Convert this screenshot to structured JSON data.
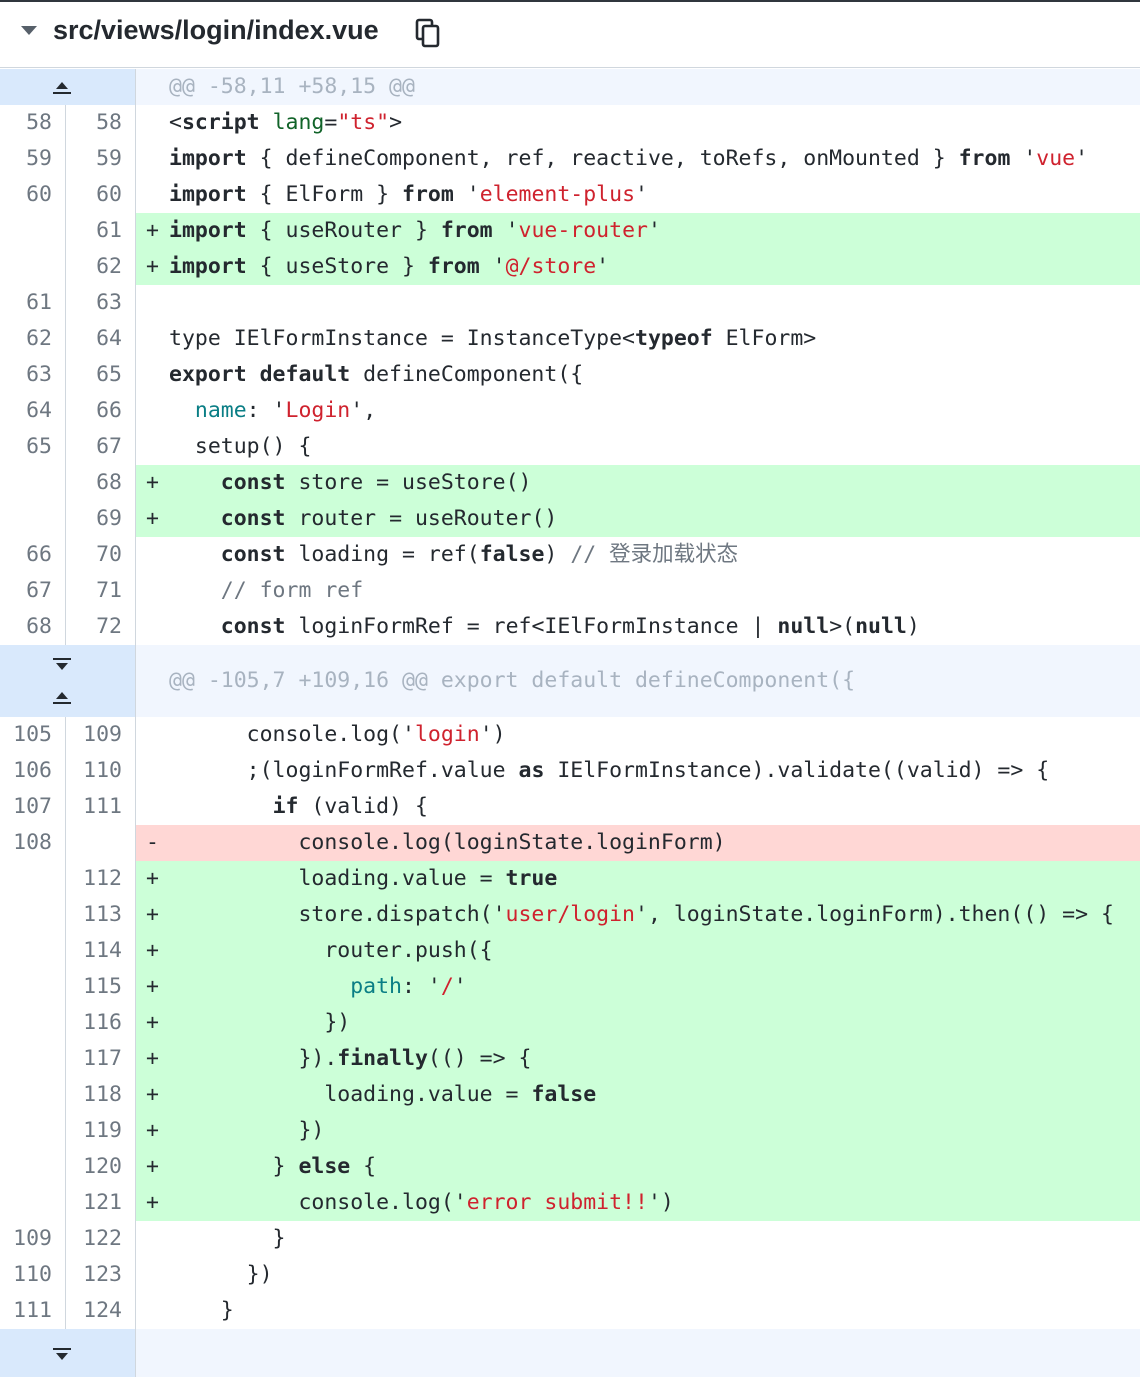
{
  "file": {
    "path": "src/views/login/index.vue",
    "icons": {
      "toggle": "chevron-down-icon",
      "copy": "copy-icon"
    }
  },
  "colors": {
    "added_bg": "#ccffd8",
    "deleted_bg": "#ffd7d5",
    "hunk_bg": "#f1f6fe",
    "expander_bg": "#d9e9fc",
    "string": "#cf222e",
    "property": "#0a7e85"
  },
  "rows": [
    {
      "type": "hunk",
      "expand": "up",
      "text": "@@ -58,11 +58,15 @@"
    },
    {
      "type": "ctx",
      "old": "58",
      "new": "58",
      "parts": [
        [
          "p",
          "<"
        ],
        [
          "k",
          "script"
        ],
        [
          "p",
          " "
        ],
        [
          "a",
          "lang"
        ],
        [
          "p",
          "="
        ],
        [
          "s",
          "\"ts\""
        ],
        [
          "p",
          ">"
        ]
      ]
    },
    {
      "type": "ctx",
      "old": "59",
      "new": "59",
      "parts": [
        [
          "k",
          "import"
        ],
        [
          "p",
          " { defineComponent, ref, reactive, toRefs, onMounted } "
        ],
        [
          "k",
          "from"
        ],
        [
          "p",
          " '"
        ],
        [
          "s",
          "vue"
        ],
        [
          "p",
          "'"
        ]
      ]
    },
    {
      "type": "ctx",
      "old": "60",
      "new": "60",
      "parts": [
        [
          "k",
          "import"
        ],
        [
          "p",
          " { ElForm } "
        ],
        [
          "k",
          "from"
        ],
        [
          "p",
          " '"
        ],
        [
          "s",
          "element-plus"
        ],
        [
          "p",
          "'"
        ]
      ]
    },
    {
      "type": "add",
      "old": "",
      "new": "61",
      "parts": [
        [
          "k",
          "import"
        ],
        [
          "p",
          " { useRouter } "
        ],
        [
          "k",
          "from"
        ],
        [
          "p",
          " '"
        ],
        [
          "s",
          "vue-router"
        ],
        [
          "p",
          "'"
        ]
      ]
    },
    {
      "type": "add",
      "old": "",
      "new": "62",
      "parts": [
        [
          "k",
          "import"
        ],
        [
          "p",
          " { useStore } "
        ],
        [
          "k",
          "from"
        ],
        [
          "p",
          " '"
        ],
        [
          "s",
          "@/store"
        ],
        [
          "p",
          "'"
        ]
      ]
    },
    {
      "type": "ctx",
      "old": "61",
      "new": "63",
      "parts": []
    },
    {
      "type": "ctx",
      "old": "62",
      "new": "64",
      "parts": [
        [
          "p",
          "type IElFormInstance = InstanceType<"
        ],
        [
          "k",
          "typeof"
        ],
        [
          "p",
          " ElForm>"
        ]
      ]
    },
    {
      "type": "ctx",
      "old": "63",
      "new": "65",
      "parts": [
        [
          "k",
          "export default"
        ],
        [
          "p",
          " defineComponent({"
        ]
      ]
    },
    {
      "type": "ctx",
      "old": "64",
      "new": "66",
      "parts": [
        [
          "p",
          "  "
        ],
        [
          "r",
          "name"
        ],
        [
          "p",
          ": '"
        ],
        [
          "s",
          "Login"
        ],
        [
          "p",
          "',"
        ]
      ]
    },
    {
      "type": "ctx",
      "old": "65",
      "new": "67",
      "parts": [
        [
          "p",
          "  setup() {"
        ]
      ]
    },
    {
      "type": "add",
      "old": "",
      "new": "68",
      "parts": [
        [
          "p",
          "    "
        ],
        [
          "k",
          "const"
        ],
        [
          "p",
          " store = useStore()"
        ]
      ]
    },
    {
      "type": "add",
      "old": "",
      "new": "69",
      "parts": [
        [
          "p",
          "    "
        ],
        [
          "k",
          "const"
        ],
        [
          "p",
          " router = useRouter()"
        ]
      ]
    },
    {
      "type": "ctx",
      "old": "66",
      "new": "70",
      "parts": [
        [
          "p",
          "    "
        ],
        [
          "k",
          "const"
        ],
        [
          "p",
          " loading = ref("
        ],
        [
          "k",
          "false"
        ],
        [
          "p",
          ") "
        ],
        [
          "c",
          "// 登录加载状态"
        ]
      ]
    },
    {
      "type": "ctx",
      "old": "67",
      "new": "71",
      "parts": [
        [
          "p",
          "    "
        ],
        [
          "c",
          "// form ref"
        ]
      ]
    },
    {
      "type": "ctx",
      "old": "68",
      "new": "72",
      "parts": [
        [
          "p",
          "    "
        ],
        [
          "k",
          "const"
        ],
        [
          "p",
          " loginFormRef = ref<IElFormInstance | "
        ],
        [
          "k",
          "null"
        ],
        [
          "p",
          ">("
        ],
        [
          "k",
          "null"
        ],
        [
          "p",
          ")"
        ]
      ]
    },
    {
      "type": "hunk",
      "expand": "both",
      "text": "@@ -105,7 +109,16 @@ export default defineComponent({"
    },
    {
      "type": "ctx",
      "old": "105",
      "new": "109",
      "parts": [
        [
          "p",
          "      console.log('"
        ],
        [
          "s",
          "login"
        ],
        [
          "p",
          "')"
        ]
      ]
    },
    {
      "type": "ctx",
      "old": "106",
      "new": "110",
      "parts": [
        [
          "p",
          "      ;(loginFormRef.value "
        ],
        [
          "k",
          "as"
        ],
        [
          "p",
          " IElFormInstance).validate((valid) => {"
        ]
      ]
    },
    {
      "type": "ctx",
      "old": "107",
      "new": "111",
      "parts": [
        [
          "p",
          "        "
        ],
        [
          "k",
          "if"
        ],
        [
          "p",
          " (valid) {"
        ]
      ]
    },
    {
      "type": "del",
      "old": "108",
      "new": "",
      "parts": [
        [
          "p",
          "          console.log(loginState.loginForm)"
        ]
      ]
    },
    {
      "type": "add",
      "old": "",
      "new": "112",
      "parts": [
        [
          "p",
          "          loading.value = "
        ],
        [
          "k",
          "true"
        ]
      ]
    },
    {
      "type": "add",
      "old": "",
      "new": "113",
      "parts": [
        [
          "p",
          "          store.dispatch('"
        ],
        [
          "s",
          "user/login"
        ],
        [
          "p",
          "', loginState.loginForm).then(() => {"
        ]
      ]
    },
    {
      "type": "add",
      "old": "",
      "new": "114",
      "parts": [
        [
          "p",
          "            router.push({"
        ]
      ]
    },
    {
      "type": "add",
      "old": "",
      "new": "115",
      "parts": [
        [
          "p",
          "              "
        ],
        [
          "r",
          "path"
        ],
        [
          "p",
          ": '"
        ],
        [
          "s",
          "/"
        ],
        [
          "p",
          "'"
        ]
      ]
    },
    {
      "type": "add",
      "old": "",
      "new": "116",
      "parts": [
        [
          "p",
          "            })"
        ]
      ]
    },
    {
      "type": "add",
      "old": "",
      "new": "117",
      "parts": [
        [
          "p",
          "          })."
        ],
        [
          "k",
          "finally"
        ],
        [
          "p",
          "(() => {"
        ]
      ]
    },
    {
      "type": "add",
      "old": "",
      "new": "118",
      "parts": [
        [
          "p",
          "            loading.value = "
        ],
        [
          "k",
          "false"
        ]
      ]
    },
    {
      "type": "add",
      "old": "",
      "new": "119",
      "parts": [
        [
          "p",
          "          })"
        ]
      ]
    },
    {
      "type": "add",
      "old": "",
      "new": "120",
      "parts": [
        [
          "p",
          "        } "
        ],
        [
          "k",
          "else"
        ],
        [
          "p",
          " {"
        ]
      ]
    },
    {
      "type": "add",
      "old": "",
      "new": "121",
      "parts": [
        [
          "p",
          "          console.log('"
        ],
        [
          "s",
          "error submit!!"
        ],
        [
          "p",
          "')"
        ]
      ]
    },
    {
      "type": "ctx",
      "old": "109",
      "new": "122",
      "parts": [
        [
          "p",
          "        }"
        ]
      ]
    },
    {
      "type": "ctx",
      "old": "110",
      "new": "123",
      "parts": [
        [
          "p",
          "      })"
        ]
      ]
    },
    {
      "type": "ctx",
      "old": "111",
      "new": "124",
      "parts": [
        [
          "p",
          "    }"
        ]
      ]
    },
    {
      "type": "hunk",
      "expand": "down",
      "text": ""
    }
  ]
}
